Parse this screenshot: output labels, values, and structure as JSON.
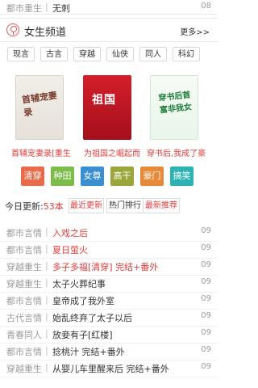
{
  "top_item": {
    "category": "都市重生",
    "title": "无刺",
    "date": "08"
  },
  "channel": {
    "name": "女生频道",
    "more": "更多>>"
  },
  "tabs": [
    "现言",
    "古言",
    "穿越",
    "仙侠",
    "同人",
    "科幻"
  ],
  "books": [
    {
      "title": "首辅宠妻录[重生",
      "cover_text": "首辅宠妻录"
    },
    {
      "title": "为祖国之崛起而",
      "cover_text": "祖国"
    },
    {
      "title": "穿书后,我成了豪",
      "cover_text": "穿书后首富非我女"
    }
  ],
  "categories": [
    "清穿",
    "种田",
    "女尊",
    "高干",
    "豪门",
    "搞笑"
  ],
  "update": {
    "label": "今日更新:",
    "count": "53本",
    "tabs": [
      "最近更新",
      "热门排行",
      "最新推荐"
    ]
  },
  "list": [
    {
      "category": "都市言情",
      "title": "入戏之后",
      "date": "09"
    },
    {
      "category": "都市言情",
      "title": "夏日萤火",
      "date": "09"
    },
    {
      "category": "穿越重生",
      "title": "多子多福[清穿] 完结+番外",
      "date": "09"
    },
    {
      "category": "穿越重生",
      "title": "太子火葬纪事",
      "date": "09"
    },
    {
      "category": "都市言情",
      "title": "皇帝成了我外室",
      "date": "09"
    },
    {
      "category": "古代言情",
      "title": "始乱终弃了太子以后",
      "date": "09"
    },
    {
      "category": "青春同人",
      "title": "放妾有子[红楼]",
      "date": "09"
    },
    {
      "category": "都市言情",
      "title": "捻桃汁 完结+番外",
      "date": "09"
    },
    {
      "category": "穿越重生",
      "title": "从婴儿车里醒来后 完结+番外",
      "date": "09"
    }
  ]
}
